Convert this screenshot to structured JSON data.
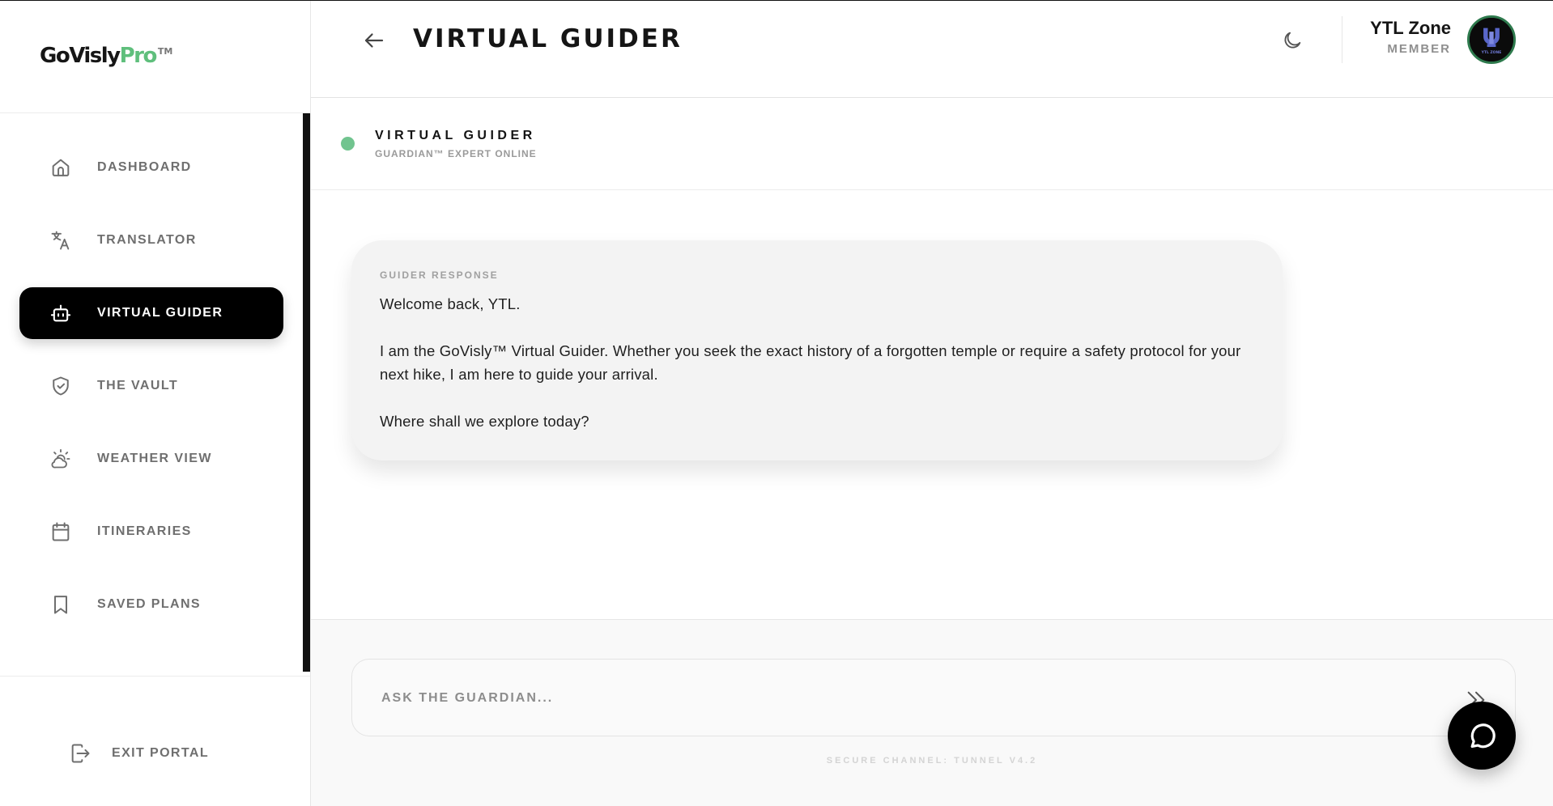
{
  "brand": {
    "name_main": "GoVisly",
    "name_accent": "Pro",
    "trademark": "TM",
    "accent_color": "#5fbf7c"
  },
  "sidebar": {
    "items": [
      {
        "label": "DASHBOARD",
        "icon": "home-icon"
      },
      {
        "label": "TRANSLATOR",
        "icon": "translate-icon"
      },
      {
        "label": "VIRTUAL GUIDER",
        "icon": "bot-icon",
        "active": true
      },
      {
        "label": "THE VAULT",
        "icon": "shield-check-icon"
      },
      {
        "label": "WEATHER VIEW",
        "icon": "cloud-sun-icon"
      },
      {
        "label": "ITINERARIES",
        "icon": "calendar-icon"
      },
      {
        "label": "SAVED PLANS",
        "icon": "bookmark-icon"
      }
    ],
    "exit_label": "EXIT PORTAL"
  },
  "header": {
    "title": "VIRTUAL GUIDER",
    "user": {
      "name": "YTL Zone",
      "role": "MEMBER",
      "avatar_text": "YTL ZONE"
    }
  },
  "chat": {
    "title": "VIRTUAL GUIDER",
    "subtitle": "GUARDIAN™ EXPERT ONLINE",
    "status_color": "#71c48f",
    "messages": [
      {
        "label": "GUIDER RESPONSE",
        "paragraphs": [
          "Welcome back, YTL.",
          "I am the GoVisly™ Virtual Guider. Whether you seek the exact history of a forgotten temple or require a safety protocol for your next hike, I am here to guide your arrival.",
          "Where shall we explore today?"
        ]
      }
    ]
  },
  "composer": {
    "placeholder": "ASK THE GUARDIAN...",
    "value": "",
    "footnote": "SECURE CHANNEL: TUNNEL V4.2"
  }
}
